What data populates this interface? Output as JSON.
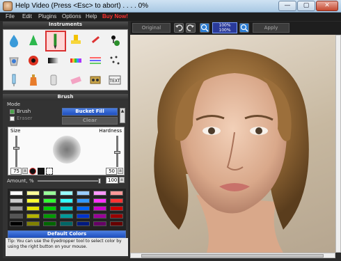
{
  "window": {
    "title": "Help Video (Press <Esc> to abort) . . . . 0%",
    "minimize_glyph": "—",
    "maximize_glyph": "▢",
    "close_glyph": "✕"
  },
  "menu": {
    "items": [
      "File",
      "Edit",
      "Plugins",
      "Options",
      "Help",
      "Buy Now!"
    ]
  },
  "colors": {
    "accent_blue": "#1f4fbf",
    "buy_now_red": "#ff3030",
    "selected_tool": "#d93030"
  },
  "instruments": {
    "header": "Instruments",
    "tools": [
      "water-drop-icon",
      "cone-icon",
      "brush-icon",
      "stamp-icon",
      "pen-icon",
      "joystick-icon",
      "bucket-icon",
      "color-circle-icon",
      "gradient-icon",
      "rainbow-icon",
      "lines-icon",
      "scatter-icon",
      "syringe-icon",
      "bottle-icon",
      "tube-icon",
      "eraser-icon",
      "tape-icon",
      "text-icon"
    ],
    "text_tool_label": "TEXT"
  },
  "brush": {
    "header": "Brush",
    "mode_label": "Mode",
    "brush_label": "Brush",
    "eraser_label": "Eraser",
    "bucket_fill_label": "Bucket Fill",
    "clear_label": "Clear",
    "size_label": "Size",
    "hardness_label": "Hardness",
    "size_value": "75",
    "hardness_value": "50",
    "amount_label": "Amount, %",
    "amount_value": "100",
    "default_colors_label": "Default Colors",
    "tip": "Tip: You can use the Eyedropper tool to select color by using the right button on your mouse."
  },
  "palette": [
    [
      "#ffffff",
      "#ffff99",
      "#99ff99",
      "#99ffff",
      "#99ccff",
      "#ff99ff",
      "#ff9999"
    ],
    [
      "#cccccc",
      "#ffff33",
      "#33ff33",
      "#33ffff",
      "#3399ff",
      "#ff33ff",
      "#ff3333"
    ],
    [
      "#999999",
      "#e6e600",
      "#00cc00",
      "#00cccc",
      "#0066ff",
      "#cc00cc",
      "#cc0000"
    ],
    [
      "#555555",
      "#b3b300",
      "#009900",
      "#009999",
      "#0033cc",
      "#990099",
      "#990000"
    ],
    [
      "#000000",
      "#808000",
      "#006600",
      "#006666",
      "#001a80",
      "#660066",
      "#660000"
    ]
  ],
  "toolbar": {
    "original_label": "Original",
    "apply_label": "Apply",
    "zoom_top": "100%",
    "zoom_bottom": "100%"
  }
}
